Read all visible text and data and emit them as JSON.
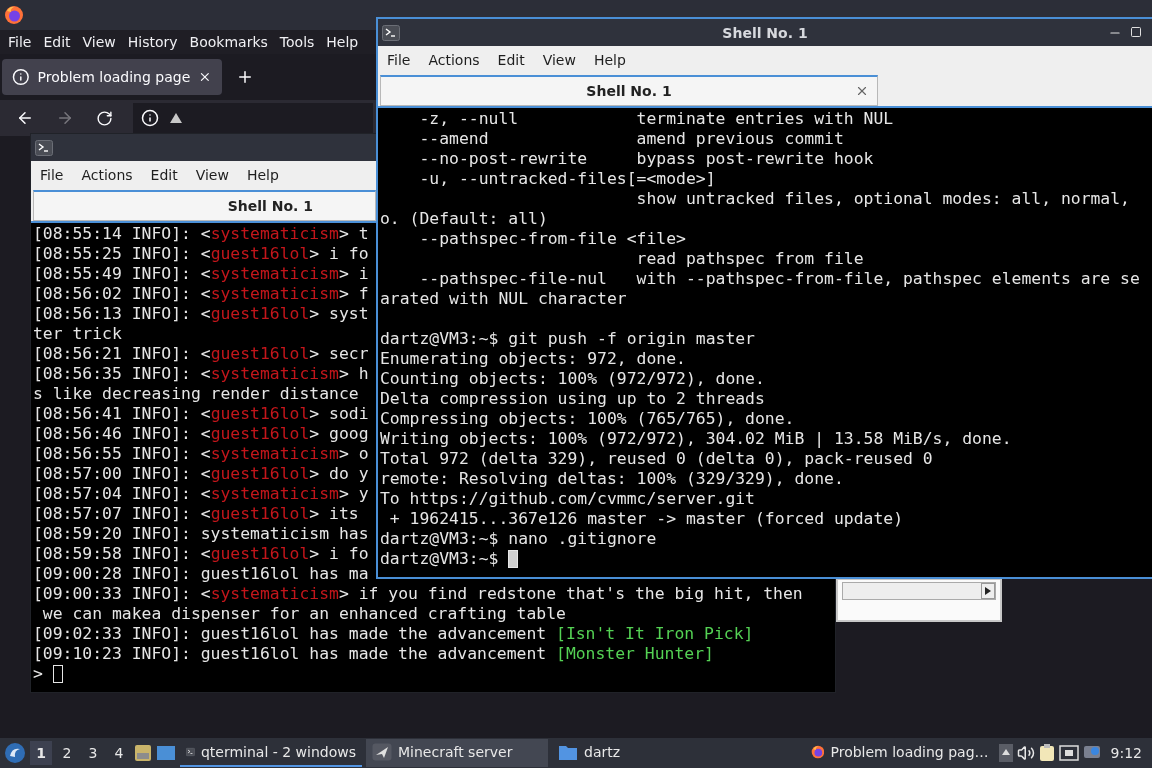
{
  "firefox": {
    "menu": [
      "File",
      "Edit",
      "View",
      "History",
      "Bookmarks",
      "Tools",
      "Help"
    ],
    "tabs": [
      {
        "title": "Problem loading page",
        "selected": true
      }
    ],
    "nav": [
      {
        "kind": "back",
        "disabled": false
      },
      {
        "kind": "forward",
        "disabled": true
      },
      {
        "kind": "reload",
        "disabled": false
      }
    ]
  },
  "back_terminal": {
    "menu": [
      "File",
      "Actions",
      "Edit",
      "View",
      "Help"
    ],
    "tab": "Shell No. 1",
    "lines": [
      {
        "segments": [
          {
            "kind": "plain",
            "text": "[08:55:14 INFO]: <"
          },
          {
            "kind": "player",
            "text": "systematicism"
          },
          {
            "kind": "plain",
            "text": "> t"
          }
        ]
      },
      {
        "segments": [
          {
            "kind": "plain",
            "text": "[08:55:25 INFO]: <"
          },
          {
            "kind": "player",
            "text": "guest16lol"
          },
          {
            "kind": "plain",
            "text": "> i fo"
          }
        ]
      },
      {
        "segments": [
          {
            "kind": "plain",
            "text": "[08:55:49 INFO]: <"
          },
          {
            "kind": "player",
            "text": "systematicism"
          },
          {
            "kind": "plain",
            "text": "> i"
          }
        ]
      },
      {
        "segments": [
          {
            "kind": "plain",
            "text": "[08:56:02 INFO]: <"
          },
          {
            "kind": "player",
            "text": "systematicism"
          },
          {
            "kind": "plain",
            "text": "> f"
          }
        ]
      },
      {
        "segments": [
          {
            "kind": "plain",
            "text": "[08:56:13 INFO]: <"
          },
          {
            "kind": "player",
            "text": "guest16lol"
          },
          {
            "kind": "plain",
            "text": "> syst"
          }
        ]
      },
      {
        "segments": [
          {
            "kind": "plain",
            "text": "ter trick"
          }
        ]
      },
      {
        "segments": [
          {
            "kind": "plain",
            "text": "[08:56:21 INFO]: <"
          },
          {
            "kind": "player",
            "text": "guest16lol"
          },
          {
            "kind": "plain",
            "text": "> secr"
          }
        ]
      },
      {
        "segments": [
          {
            "kind": "plain",
            "text": "[08:56:35 INFO]: <"
          },
          {
            "kind": "player",
            "text": "systematicism"
          },
          {
            "kind": "plain",
            "text": "> h"
          }
        ]
      },
      {
        "segments": [
          {
            "kind": "plain",
            "text": "s like decreasing render distance"
          }
        ]
      },
      {
        "segments": [
          {
            "kind": "plain",
            "text": "[08:56:41 INFO]: <"
          },
          {
            "kind": "player",
            "text": "guest16lol"
          },
          {
            "kind": "plain",
            "text": "> sodi"
          }
        ]
      },
      {
        "segments": [
          {
            "kind": "plain",
            "text": "[08:56:46 INFO]: <"
          },
          {
            "kind": "player",
            "text": "guest16lol"
          },
          {
            "kind": "plain",
            "text": "> goog"
          }
        ]
      },
      {
        "segments": [
          {
            "kind": "plain",
            "text": "[08:56:55 INFO]: <"
          },
          {
            "kind": "player",
            "text": "systematicism"
          },
          {
            "kind": "plain",
            "text": "> o"
          }
        ]
      },
      {
        "segments": [
          {
            "kind": "plain",
            "text": "[08:57:00 INFO]: <"
          },
          {
            "kind": "player",
            "text": "guest16lol"
          },
          {
            "kind": "plain",
            "text": "> do y"
          }
        ]
      },
      {
        "segments": [
          {
            "kind": "plain",
            "text": "[08:57:04 INFO]: <"
          },
          {
            "kind": "player",
            "text": "systematicism"
          },
          {
            "kind": "plain",
            "text": "> y"
          }
        ]
      },
      {
        "segments": [
          {
            "kind": "plain",
            "text": "[08:57:07 INFO]: <"
          },
          {
            "kind": "player",
            "text": "guest16lol"
          },
          {
            "kind": "plain",
            "text": "> its"
          }
        ]
      },
      {
        "segments": [
          {
            "kind": "plain",
            "text": "[08:59:20 INFO]: systematicism has"
          }
        ]
      },
      {
        "segments": [
          {
            "kind": "plain",
            "text": "[08:59:58 INFO]: <"
          },
          {
            "kind": "player",
            "text": "guest16lol"
          },
          {
            "kind": "plain",
            "text": "> i fo"
          }
        ]
      },
      {
        "segments": [
          {
            "kind": "plain",
            "text": "[09:00:28 INFO]: guest16lol has ma"
          }
        ]
      },
      {
        "segments": [
          {
            "kind": "plain",
            "text": "[09:00:33 INFO]: <"
          },
          {
            "kind": "player",
            "text": "systematicism"
          },
          {
            "kind": "plain",
            "text": "> if you find redstone that's the big hit, then"
          }
        ]
      },
      {
        "segments": [
          {
            "kind": "plain",
            "text": " we can makea dispenser for an enhanced crafting table"
          }
        ]
      },
      {
        "segments": [
          {
            "kind": "plain",
            "text": "[09:02:33 INFO]: guest16lol has made the advancement "
          },
          {
            "kind": "advancement",
            "text": "[Isn't It Iron Pick]"
          }
        ]
      },
      {
        "segments": [
          {
            "kind": "plain",
            "text": "[09:10:23 INFO]: guest16lol has made the advancement "
          },
          {
            "kind": "advancement",
            "text": "[Monster Hunter]"
          }
        ]
      },
      {
        "segments": [
          {
            "kind": "plain",
            "text": ">"
          }
        ],
        "cursor": true,
        "cursor_filled": false
      }
    ]
  },
  "front_terminal": {
    "title": "Shell No. 1",
    "menu": [
      "File",
      "Actions",
      "Edit",
      "View",
      "Help"
    ],
    "tab": "Shell No. 1",
    "lines": [
      {
        "segments": [
          {
            "kind": "plain",
            "text": "    -z, --null            terminate entries with NUL"
          }
        ]
      },
      {
        "segments": [
          {
            "kind": "plain",
            "text": "    --amend               amend previous commit"
          }
        ]
      },
      {
        "segments": [
          {
            "kind": "plain",
            "text": "    --no-post-rewrite     bypass post-rewrite hook"
          }
        ]
      },
      {
        "segments": [
          {
            "kind": "plain",
            "text": "    -u, --untracked-files[=<mode>]"
          }
        ]
      },
      {
        "segments": [
          {
            "kind": "plain",
            "text": "                          show untracked files, optional modes: all, normal,"
          }
        ]
      },
      {
        "segments": [
          {
            "kind": "plain",
            "text": "o. (Default: all)"
          }
        ]
      },
      {
        "segments": [
          {
            "kind": "plain",
            "text": "    --pathspec-from-file <file>"
          }
        ]
      },
      {
        "segments": [
          {
            "kind": "plain",
            "text": "                          read pathspec from file"
          }
        ]
      },
      {
        "segments": [
          {
            "kind": "plain",
            "text": "    --pathspec-file-nul   with --pathspec-from-file, pathspec elements are se"
          }
        ]
      },
      {
        "segments": [
          {
            "kind": "plain",
            "text": "arated with NUL character"
          }
        ]
      },
      {
        "segments": [
          {
            "kind": "plain",
            "text": "dartz@VM3:~$ git push -f origin master"
          }
        ],
        "gap_before": true
      },
      {
        "segments": [
          {
            "kind": "plain",
            "text": "Enumerating objects: 972, done."
          }
        ]
      },
      {
        "segments": [
          {
            "kind": "plain",
            "text": "Counting objects: 100% (972/972), done."
          }
        ]
      },
      {
        "segments": [
          {
            "kind": "plain",
            "text": "Delta compression using up to 2 threads"
          }
        ]
      },
      {
        "segments": [
          {
            "kind": "plain",
            "text": "Compressing objects: 100% (765/765), done."
          }
        ]
      },
      {
        "segments": [
          {
            "kind": "plain",
            "text": "Writing objects: 100% (972/972), 304.02 MiB | 13.58 MiB/s, done."
          }
        ]
      },
      {
        "segments": [
          {
            "kind": "plain",
            "text": "Total 972 (delta 329), reused 0 (delta 0), pack-reused 0"
          }
        ]
      },
      {
        "segments": [
          {
            "kind": "plain",
            "text": "remote: Resolving deltas: 100% (329/329), done."
          }
        ]
      },
      {
        "segments": [
          {
            "kind": "plain",
            "text": "To https://github.com/cvmmc/server.git"
          }
        ]
      },
      {
        "segments": [
          {
            "kind": "plain",
            "text": " + 1962415...367e126 master -> master (forced update)"
          }
        ]
      },
      {
        "segments": [
          {
            "kind": "plain",
            "text": "dartz@VM3:~$ nano .gitignore"
          }
        ]
      },
      {
        "segments": [
          {
            "kind": "plain",
            "text": "dartz@VM3:~$"
          }
        ],
        "cursor": true,
        "cursor_filled": true
      }
    ]
  },
  "taskbar": {
    "workspaces": [
      {
        "label": "1",
        "selected": true
      },
      {
        "label": "2",
        "selected": false
      },
      {
        "label": "3",
        "selected": false
      },
      {
        "label": "4",
        "selected": false
      }
    ],
    "tasks": [
      {
        "kind": "terminal",
        "label": "qterminal - 2 windows",
        "selected": true,
        "hovered": false
      },
      {
        "kind": "server",
        "label": "Minecraft server",
        "selected": false,
        "hovered": true
      },
      {
        "kind": "folder",
        "label": "dartz",
        "selected": false,
        "hovered": false
      },
      {
        "kind": "firefox",
        "label": "Problem loading pag…",
        "selected": false,
        "hovered": false
      }
    ],
    "clock": "9:12"
  }
}
